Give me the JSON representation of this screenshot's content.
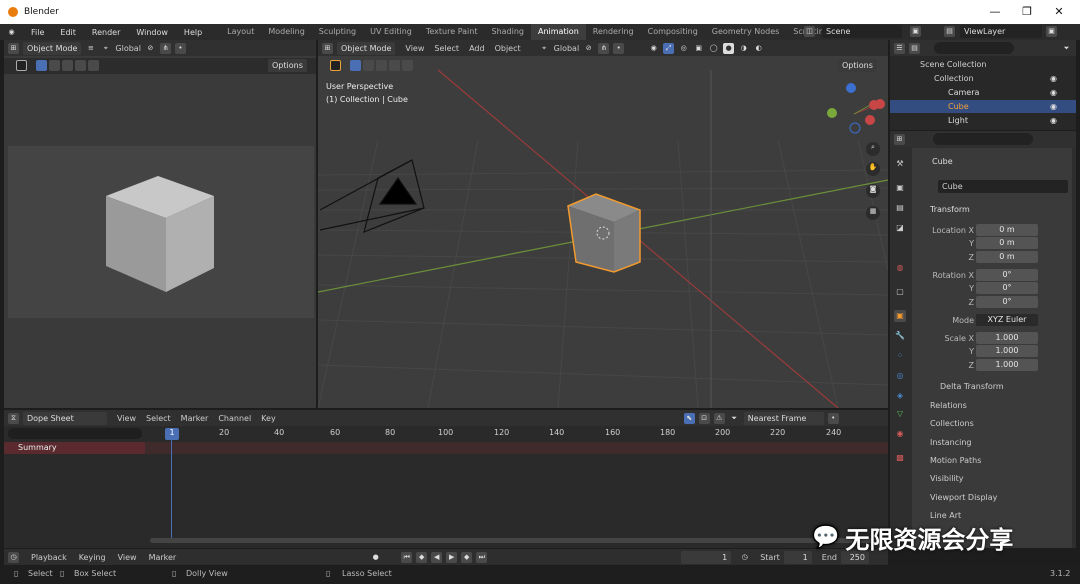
{
  "app_title": "Blender",
  "window_controls": [
    "—",
    "❐",
    "✕"
  ],
  "menu": [
    "File",
    "Edit",
    "Render",
    "Window",
    "Help"
  ],
  "workspaces": [
    "Layout",
    "Modeling",
    "Sculpting",
    "UV Editing",
    "Texture Paint",
    "Shading",
    "Animation",
    "Rendering",
    "Compositing",
    "Geometry Nodes",
    "Scripting",
    "+"
  ],
  "active_workspace": "Animation",
  "scene": "Scene",
  "view_layer": "ViewLayer",
  "left_view": {
    "mode": "Object Mode",
    "orientation": "Global",
    "options": "Options"
  },
  "main_view": {
    "mode": "Object Mode",
    "menus": [
      "View",
      "Select",
      "Add",
      "Object"
    ],
    "orientation": "Global",
    "options": "Options",
    "perspective": "User Perspective",
    "collection_info": "(1) Collection | Cube"
  },
  "outliner": {
    "root": "Scene Collection",
    "collection": "Collection",
    "items": [
      "Camera",
      "Cube",
      "Light"
    ]
  },
  "properties": {
    "object_name": "Cube",
    "data_name": "Cube",
    "transform_label": "Transform",
    "location": {
      "label_x": "Location X",
      "label_y": "Y",
      "label_z": "Z",
      "x": "0 m",
      "y": "0 m",
      "z": "0 m"
    },
    "rotation": {
      "label_x": "Rotation X",
      "label_y": "Y",
      "label_z": "Z",
      "x": "0°",
      "y": "0°",
      "z": "0°"
    },
    "mode_label": "Mode",
    "mode": "XYZ Euler",
    "scale": {
      "label_x": "Scale X",
      "label_y": "Y",
      "label_z": "Z",
      "x": "1.000",
      "y": "1.000",
      "z": "1.000"
    },
    "delta": "Delta Transform",
    "sections": [
      "Relations",
      "Collections",
      "Instancing",
      "Motion Paths",
      "Visibility",
      "Viewport Display",
      "Line Art"
    ]
  },
  "dopesheet": {
    "mode": "Dope Sheet",
    "menus": [
      "View",
      "Select",
      "Marker",
      "Channel",
      "Key"
    ],
    "snap": "Nearest Frame",
    "summary": "Summary",
    "current_frame_tag": "1",
    "frames": [
      "20",
      "40",
      "60",
      "80",
      "100",
      "120",
      "140",
      "160",
      "180",
      "200",
      "220",
      "240"
    ]
  },
  "timeline": {
    "menus": [
      "Playback",
      "Keying",
      "View",
      "Marker"
    ],
    "current_frame": "1",
    "start_label": "Start",
    "start": "1",
    "end_label": "End",
    "end": "250"
  },
  "status": {
    "select": "Select",
    "box_select": "Box Select",
    "dolly": "Dolly View",
    "lasso": "Lasso Select",
    "version": "3.1.2"
  },
  "watermark": "无限资源会分享"
}
